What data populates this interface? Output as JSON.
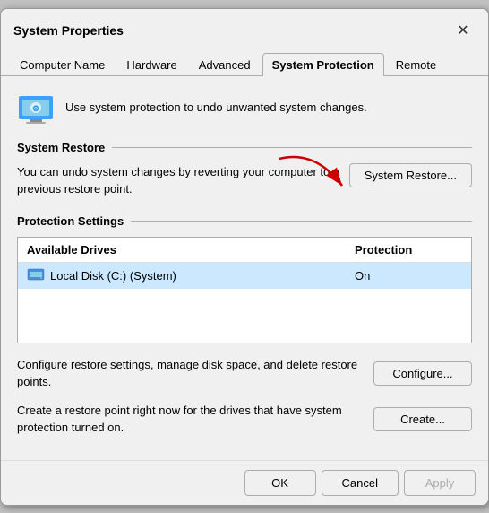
{
  "dialog": {
    "title": "System Properties",
    "close_label": "✕"
  },
  "tabs": [
    {
      "id": "computer-name",
      "label": "Computer Name",
      "active": false
    },
    {
      "id": "hardware",
      "label": "Hardware",
      "active": false
    },
    {
      "id": "advanced",
      "label": "Advanced",
      "active": false
    },
    {
      "id": "system-protection",
      "label": "System Protection",
      "active": true
    },
    {
      "id": "remote",
      "label": "Remote",
      "active": false
    }
  ],
  "info": {
    "text": "Use system protection to undo unwanted system changes."
  },
  "system_restore": {
    "section_title": "System Restore",
    "description": "You can undo system changes by reverting your computer to a previous restore point.",
    "button_label": "System Restore..."
  },
  "protection_settings": {
    "section_title": "Protection Settings",
    "columns": {
      "drive": "Available Drives",
      "protection": "Protection"
    },
    "rows": [
      {
        "drive": "Local Disk (C:) (System)",
        "protection": "On",
        "selected": true
      }
    ]
  },
  "configure": {
    "text": "Configure restore settings, manage disk space, and delete restore points.",
    "button_label": "Configure..."
  },
  "create": {
    "text": "Create a restore point right now for the drives that have system protection turned on.",
    "button_label": "Create..."
  },
  "footer": {
    "ok_label": "OK",
    "cancel_label": "Cancel",
    "apply_label": "Apply"
  }
}
